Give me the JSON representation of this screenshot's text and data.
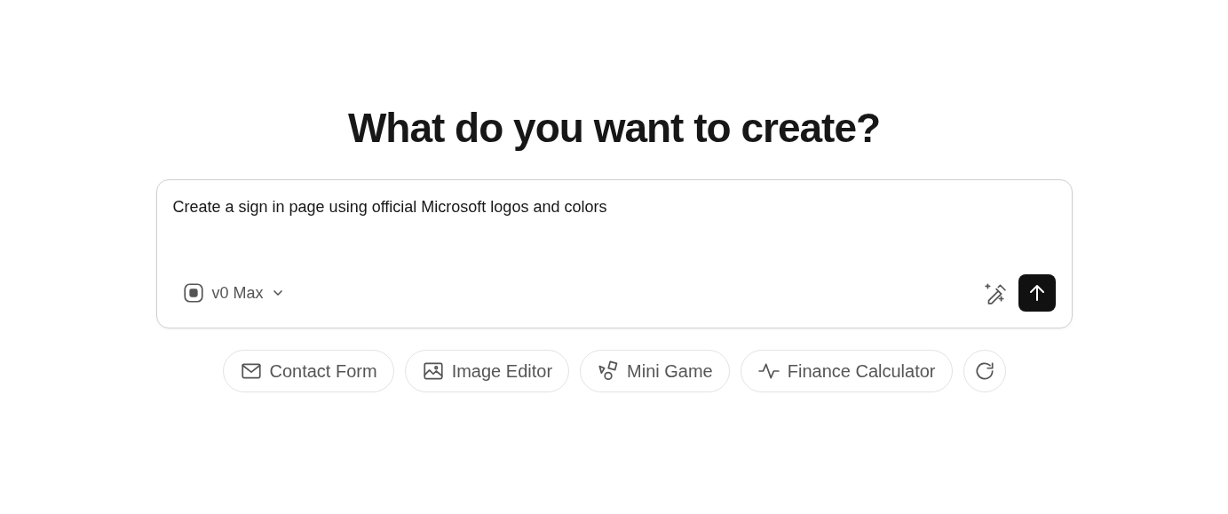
{
  "heading": "What do you want to create?",
  "prompt": {
    "value": "Create a sign in page using official Microsoft logos and colors",
    "model": "v0 Max"
  },
  "suggestions": [
    {
      "label": "Contact Form"
    },
    {
      "label": "Image Editor"
    },
    {
      "label": "Mini Game"
    },
    {
      "label": "Finance Calculator"
    }
  ]
}
